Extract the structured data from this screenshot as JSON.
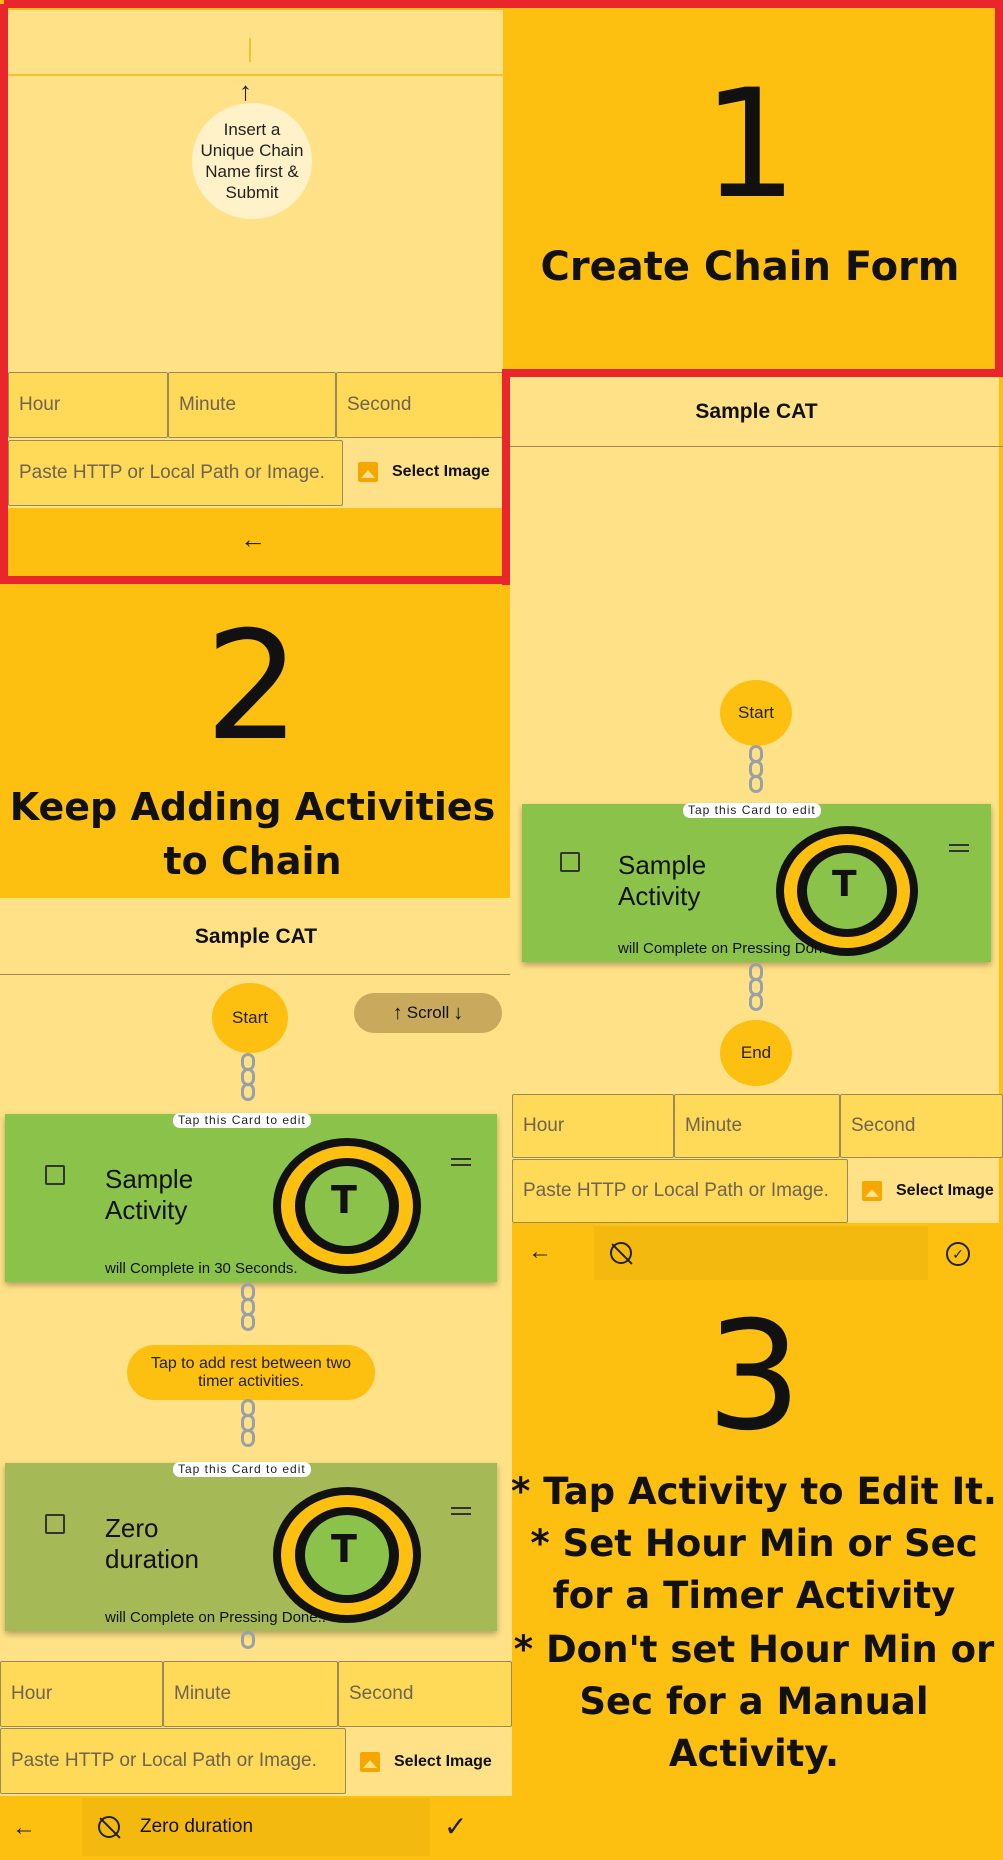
{
  "panel1": {
    "number": "1",
    "title": "Create Chain Form",
    "hint": "Insert a Unique Chain Name first & Submit",
    "hour_placeholder": "Hour",
    "minute_placeholder": "Minute",
    "second_placeholder": "Second",
    "image_placeholder": "Paste HTTP or Local Path or Image.",
    "select_image_label": "Select Image",
    "back_icon": "arrow-left-icon",
    "up_icon": "arrow-up-icon"
  },
  "panel2": {
    "number": "2",
    "title": "Keep Adding Activities to Chain",
    "chain_name": "Sample CAT",
    "start_label": "Start",
    "scroll_label": "Scroll",
    "cards": [
      {
        "hint": "Tap this Card to edit",
        "title": "Sample Activity",
        "subtitle": "will Complete in 30 Seconds."
      },
      {
        "hint": "Tap this Card to edit",
        "title": "Zero duration",
        "subtitle": "will Complete on Pressing Done.."
      }
    ],
    "rest_hint": "Tap to add rest between two timer activities.",
    "hour_placeholder": "Hour",
    "minute_placeholder": "Minute",
    "second_placeholder": "Second",
    "image_placeholder": "Paste HTTP or Local Path or Image.",
    "select_image_label": "Select Image",
    "name_value": "Zero duration"
  },
  "panel3": {
    "number": "3",
    "chain_name": "Sample CAT",
    "start_label": "Start",
    "end_label": "End",
    "card": {
      "hint": "Tap this Card to edit",
      "title": "Sample Activity",
      "subtitle": "will Complete on Pressing Done.."
    },
    "hour_placeholder": "Hour",
    "minute_placeholder": "Minute",
    "second_placeholder": "Second",
    "image_placeholder": "Paste HTTP or Local Path or Image.",
    "select_image_label": "Select Image",
    "tips": [
      "* Tap Activity to Edit It.",
      "* Set Hour Min or Sec for a Timer Activity",
      "* Don't set Hour Min or Sec for a Manual Activity."
    ]
  },
  "colors": {
    "accent_yellow": "#FDBF10",
    "pale_yellow": "#FFE287",
    "card_green": "#8BC34A",
    "highlight_red": "#E8262B"
  }
}
